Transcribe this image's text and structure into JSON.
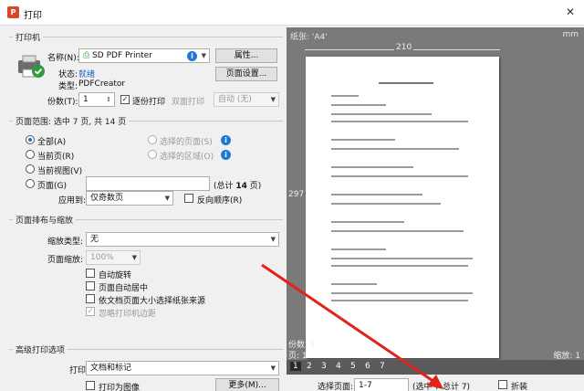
{
  "window": {
    "title": "打印",
    "close": "✕",
    "app_icon": "P"
  },
  "printer": {
    "group": "打印机",
    "name_label": "名称(N):",
    "name_value": "SD PDF Printer",
    "props_btn": "属性...",
    "status_label": "状态:",
    "status_value": "就绪",
    "type_label": "类型:",
    "type_value": "PDFCreator",
    "page_setup_btn": "页面设置...",
    "copies_label": "份数(T):",
    "copies_value": "1",
    "collate_label": "逐份打印",
    "duplex_label": "双面打印",
    "duplex_value": "自动 (无)"
  },
  "range": {
    "group": "页面范围: 选中 7 页, 共 14 页",
    "all": "全部(A)",
    "current": "当前页(R)",
    "view": "当前视图(V)",
    "pages": "页面(G)",
    "selected": "选择的页面(S)",
    "area": "选择的区域(O)",
    "total_prefix": "(总计 ",
    "total_num": "14",
    "total_suffix": " 页)",
    "apply_label": "应用到:",
    "apply_value": "仅奇数页",
    "reverse_label": "反向顺序(R)"
  },
  "layout": {
    "group": "页面排布与缩放",
    "scale_type_label": "缩放类型:",
    "scale_type_value": "无",
    "zoom_label": "页面缩放:",
    "zoom_value": "100%",
    "auto_rotate": "自动旋转",
    "auto_center": "页面自动居中",
    "by_pdf_size": "依文档页面大小选择纸张来源",
    "ignore_margins": "忽略打印机边距"
  },
  "advanced": {
    "group": "高级打印选项",
    "print_label": "打印",
    "print_value": "文档和标记",
    "as_image": "打印为图像",
    "more_btn": "更多(M)..."
  },
  "preview": {
    "paper": "纸张: 'A4'",
    "unit": "mm",
    "width": "210",
    "height": "297",
    "copies": "份数: 1",
    "page": "页: 1",
    "zoom": "缩放: 1",
    "pages": [
      "1",
      "2",
      "3",
      "4",
      "5",
      "6",
      "7"
    ]
  },
  "bottom": {
    "select_label": "选择页面:",
    "select_value": "1-7",
    "total": "(选中 7 总计 7)",
    "flip_label": "折装"
  }
}
